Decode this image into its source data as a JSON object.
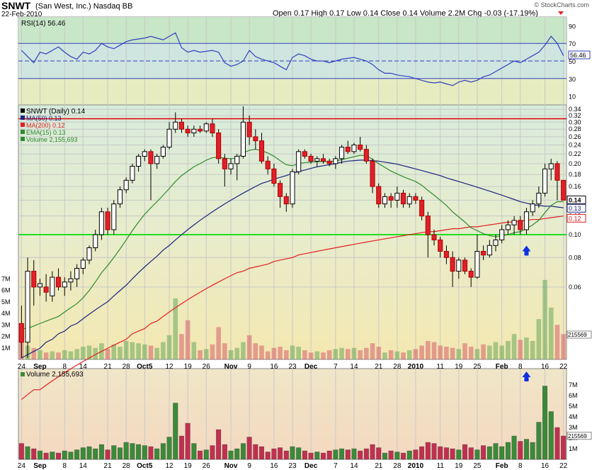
{
  "header": {
    "symbol": "SNWT",
    "company": "(San West, Inc.)",
    "exchange": "Nasdaq BB",
    "date": "22-Feb-2010",
    "open_label": "Open",
    "open": "0.17",
    "high_label": "High",
    "high": "0.17",
    "low_label": "Low",
    "low": "0.14",
    "close_label": "Close",
    "close": "0.14",
    "volume_label": "Volume",
    "volume": "2.2M",
    "chg_label": "Chg",
    "chg": "-0.03 (-17.19%)",
    "watermark": "© StockCharts.com"
  },
  "colors": {
    "up": "#2e7d2e",
    "down": "#e0202a",
    "upbody": "#ffffff",
    "ma50": "#1a237e",
    "ma200": "#e02020",
    "ema15": "#2e8b2e",
    "rsi": "#3040c0"
  },
  "chart_data": {
    "type": "candlestick",
    "x_tick_labels": [
      "24",
      "Sep",
      "8",
      "14",
      "21",
      "28",
      "Oct5",
      "12",
      "19",
      "26",
      "Nov",
      "9",
      "16",
      "23",
      "Dec",
      "7",
      "14",
      "21",
      "28",
      "2010",
      "11",
      "19",
      "25",
      "Feb",
      "8",
      "16",
      "22"
    ],
    "candles": [
      [
        0.042,
        0.05,
        0.03,
        0.035
      ],
      [
        0.035,
        0.08,
        0.03,
        0.07
      ],
      [
        0.07,
        0.078,
        0.05,
        0.06
      ],
      [
        0.06,
        0.065,
        0.055,
        0.062
      ],
      [
        0.06,
        0.068,
        0.052,
        0.057
      ],
      [
        0.055,
        0.07,
        0.052,
        0.066
      ],
      [
        0.066,
        0.072,
        0.058,
        0.06
      ],
      [
        0.06,
        0.066,
        0.055,
        0.063
      ],
      [
        0.063,
        0.07,
        0.058,
        0.065
      ],
      [
        0.065,
        0.075,
        0.06,
        0.072
      ],
      [
        0.072,
        0.08,
        0.068,
        0.078
      ],
      [
        0.078,
        0.09,
        0.075,
        0.088
      ],
      [
        0.088,
        0.105,
        0.085,
        0.1
      ],
      [
        0.1,
        0.13,
        0.095,
        0.125
      ],
      [
        0.125,
        0.13,
        0.1,
        0.105
      ],
      [
        0.105,
        0.14,
        0.1,
        0.135
      ],
      [
        0.135,
        0.16,
        0.13,
        0.155
      ],
      [
        0.155,
        0.175,
        0.15,
        0.17
      ],
      [
        0.17,
        0.2,
        0.165,
        0.195
      ],
      [
        0.195,
        0.22,
        0.185,
        0.215
      ],
      [
        0.215,
        0.23,
        0.205,
        0.225
      ],
      [
        0.225,
        0.23,
        0.14,
        0.2
      ],
      [
        0.2,
        0.22,
        0.19,
        0.215
      ],
      [
        0.215,
        0.24,
        0.21,
        0.235
      ],
      [
        0.235,
        0.3,
        0.23,
        0.28
      ],
      [
        0.28,
        0.33,
        0.27,
        0.3
      ],
      [
        0.3,
        0.31,
        0.27,
        0.28
      ],
      [
        0.28,
        0.29,
        0.26,
        0.27
      ],
      [
        0.27,
        0.29,
        0.26,
        0.28
      ],
      [
        0.28,
        0.29,
        0.27,
        0.275
      ],
      [
        0.275,
        0.3,
        0.27,
        0.295
      ],
      [
        0.295,
        0.31,
        0.26,
        0.27
      ],
      [
        0.27,
        0.28,
        0.2,
        0.21
      ],
      [
        0.21,
        0.22,
        0.16,
        0.19
      ],
      [
        0.19,
        0.21,
        0.18,
        0.2
      ],
      [
        0.2,
        0.22,
        0.17,
        0.215
      ],
      [
        0.215,
        0.35,
        0.21,
        0.3
      ],
      [
        0.3,
        0.32,
        0.24,
        0.26
      ],
      [
        0.26,
        0.28,
        0.23,
        0.25
      ],
      [
        0.25,
        0.27,
        0.2,
        0.205
      ],
      [
        0.205,
        0.215,
        0.18,
        0.19
      ],
      [
        0.19,
        0.2,
        0.16,
        0.165
      ],
      [
        0.165,
        0.17,
        0.13,
        0.145
      ],
      [
        0.145,
        0.15,
        0.125,
        0.135
      ],
      [
        0.135,
        0.19,
        0.13,
        0.185
      ],
      [
        0.185,
        0.23,
        0.18,
        0.225
      ],
      [
        0.225,
        0.23,
        0.21,
        0.215
      ],
      [
        0.215,
        0.22,
        0.2,
        0.205
      ],
      [
        0.205,
        0.215,
        0.195,
        0.21
      ],
      [
        0.21,
        0.22,
        0.2,
        0.205
      ],
      [
        0.205,
        0.21,
        0.195,
        0.2
      ],
      [
        0.2,
        0.215,
        0.19,
        0.21
      ],
      [
        0.21,
        0.24,
        0.2,
        0.235
      ],
      [
        0.235,
        0.25,
        0.22,
        0.225
      ],
      [
        0.225,
        0.245,
        0.22,
        0.24
      ],
      [
        0.24,
        0.26,
        0.225,
        0.23
      ],
      [
        0.23,
        0.24,
        0.2,
        0.205
      ],
      [
        0.205,
        0.21,
        0.15,
        0.16
      ],
      [
        0.16,
        0.165,
        0.13,
        0.135
      ],
      [
        0.135,
        0.15,
        0.13,
        0.145
      ],
      [
        0.145,
        0.15,
        0.13,
        0.14
      ],
      [
        0.14,
        0.16,
        0.13,
        0.15
      ],
      [
        0.15,
        0.155,
        0.13,
        0.135
      ],
      [
        0.135,
        0.15,
        0.13,
        0.145
      ],
      [
        0.145,
        0.15,
        0.135,
        0.14
      ],
      [
        0.14,
        0.145,
        0.115,
        0.12
      ],
      [
        0.12,
        0.125,
        0.08,
        0.1
      ],
      [
        0.1,
        0.105,
        0.09,
        0.095
      ],
      [
        0.095,
        0.098,
        0.08,
        0.085
      ],
      [
        0.085,
        0.09,
        0.075,
        0.08
      ],
      [
        0.08,
        0.085,
        0.06,
        0.07
      ],
      [
        0.07,
        0.08,
        0.065,
        0.078
      ],
      [
        0.078,
        0.08,
        0.068,
        0.07
      ],
      [
        0.07,
        0.072,
        0.06,
        0.066
      ],
      [
        0.066,
        0.1,
        0.065,
        0.085
      ],
      [
        0.085,
        0.09,
        0.078,
        0.082
      ],
      [
        0.082,
        0.095,
        0.08,
        0.09
      ],
      [
        0.09,
        0.1,
        0.085,
        0.095
      ],
      [
        0.095,
        0.11,
        0.092,
        0.105
      ],
      [
        0.105,
        0.115,
        0.1,
        0.11
      ],
      [
        0.11,
        0.12,
        0.1,
        0.115
      ],
      [
        0.115,
        0.12,
        0.1,
        0.105
      ],
      [
        0.105,
        0.13,
        0.1,
        0.125
      ],
      [
        0.125,
        0.14,
        0.12,
        0.135
      ],
      [
        0.135,
        0.16,
        0.13,
        0.15
      ],
      [
        0.15,
        0.2,
        0.145,
        0.19
      ],
      [
        0.19,
        0.21,
        0.17,
        0.2
      ],
      [
        0.2,
        0.205,
        0.14,
        0.17
      ],
      [
        0.17,
        0.17,
        0.14,
        0.14
      ]
    ],
    "volumes": [
      1.5,
      1.2,
      1.0,
      0.8,
      0.6,
      0.7,
      0.6,
      0.8,
      0.7,
      0.9,
      1.1,
      1.2,
      1.0,
      1.4,
      0.9,
      1.3,
      1.1,
      1.6,
      1.5,
      1.4,
      1.3,
      1.2,
      1.0,
      1.5,
      2.1,
      5.3,
      2.2,
      3.4,
      1.5,
      0.8,
      0.9,
      1.3,
      2.8,
      1.4,
      0.8,
      1.0,
      1.5,
      2.1,
      1.4,
      1.2,
      0.7,
      1.0,
      1.1,
      0.8,
      1.2,
      1.1,
      0.8,
      0.6,
      0.7,
      0.6,
      0.8,
      0.9,
      1.0,
      0.9,
      1.0,
      0.8,
      1.0,
      1.4,
      1.1,
      0.6,
      0.8,
      0.7,
      0.6,
      0.8,
      0.9,
      1.2,
      1.6,
      1.5,
      1.2,
      1.1,
      1.0,
      0.9,
      1.4,
      1.1,
      0.9,
      1.3,
      1.2,
      1.5,
      1.2,
      1.6,
      2.2,
      1.7,
      1.9,
      1.6,
      3.5,
      6.9,
      4.5,
      3.0,
      2.2
    ],
    "ma50": [
      0.03,
      0.031,
      0.032,
      0.033,
      0.035,
      0.036,
      0.038,
      0.039,
      0.041,
      0.042,
      0.044,
      0.046,
      0.048,
      0.05,
      0.052,
      0.055,
      0.058,
      0.061,
      0.065,
      0.069,
      0.073,
      0.077,
      0.081,
      0.086,
      0.09,
      0.095,
      0.1,
      0.105,
      0.11,
      0.115,
      0.12,
      0.125,
      0.13,
      0.135,
      0.14,
      0.145,
      0.15,
      0.155,
      0.16,
      0.165,
      0.168,
      0.172,
      0.175,
      0.178,
      0.182,
      0.185,
      0.188,
      0.191,
      0.194,
      0.196,
      0.198,
      0.2,
      0.203,
      0.205,
      0.206,
      0.207,
      0.207,
      0.206,
      0.205,
      0.203,
      0.201,
      0.199,
      0.196,
      0.193,
      0.19,
      0.187,
      0.184,
      0.181,
      0.178,
      0.174,
      0.171,
      0.168,
      0.165,
      0.162,
      0.159,
      0.156,
      0.153,
      0.15,
      0.147,
      0.144,
      0.141,
      0.138,
      0.136,
      0.134,
      0.133,
      0.132,
      0.132,
      0.131,
      0.13
    ],
    "ma200": [
      0.02,
      0.021,
      0.022,
      0.022,
      0.023,
      0.024,
      0.025,
      0.026,
      0.027,
      0.028,
      0.029,
      0.03,
      0.031,
      0.032,
      0.033,
      0.034,
      0.035,
      0.036,
      0.038,
      0.039,
      0.04,
      0.042,
      0.043,
      0.045,
      0.047,
      0.049,
      0.051,
      0.053,
      0.055,
      0.057,
      0.059,
      0.061,
      0.063,
      0.065,
      0.067,
      0.069,
      0.07,
      0.072,
      0.073,
      0.074,
      0.075,
      0.077,
      0.078,
      0.079,
      0.08,
      0.082,
      0.083,
      0.084,
      0.085,
      0.086,
      0.087,
      0.088,
      0.089,
      0.09,
      0.091,
      0.092,
      0.093,
      0.094,
      0.095,
      0.096,
      0.097,
      0.098,
      0.099,
      0.1,
      0.101,
      0.102,
      0.103,
      0.103,
      0.104,
      0.105,
      0.106,
      0.106,
      0.107,
      0.108,
      0.108,
      0.109,
      0.11,
      0.111,
      0.112,
      0.113,
      0.113,
      0.114,
      0.115,
      0.116,
      0.116,
      0.117,
      0.118,
      0.119,
      0.12
    ],
    "ema15": [
      0.04,
      0.04,
      0.041,
      0.042,
      0.043,
      0.044,
      0.045,
      0.047,
      0.049,
      0.051,
      0.054,
      0.058,
      0.063,
      0.069,
      0.074,
      0.08,
      0.087,
      0.095,
      0.104,
      0.113,
      0.122,
      0.13,
      0.138,
      0.147,
      0.157,
      0.168,
      0.178,
      0.186,
      0.194,
      0.2,
      0.207,
      0.212,
      0.213,
      0.211,
      0.21,
      0.211,
      0.222,
      0.228,
      0.23,
      0.227,
      0.222,
      0.215,
      0.206,
      0.198,
      0.196,
      0.2,
      0.202,
      0.203,
      0.204,
      0.204,
      0.204,
      0.205,
      0.208,
      0.211,
      0.214,
      0.217,
      0.216,
      0.209,
      0.2,
      0.193,
      0.186,
      0.181,
      0.176,
      0.172,
      0.168,
      0.162,
      0.154,
      0.147,
      0.14,
      0.133,
      0.125,
      0.119,
      0.113,
      0.107,
      0.104,
      0.101,
      0.099,
      0.098,
      0.099,
      0.1,
      0.102,
      0.103,
      0.106,
      0.11,
      0.115,
      0.124,
      0.133,
      0.138,
      0.138
    ],
    "rsi": [
      62,
      55,
      48,
      60,
      58,
      62,
      66,
      60,
      55,
      52,
      60,
      58,
      62,
      70,
      66,
      64,
      68,
      72,
      74,
      75,
      76,
      78,
      76,
      74,
      78,
      82,
      65,
      60,
      62,
      60,
      61,
      62,
      60,
      48,
      44,
      46,
      50,
      62,
      55,
      52,
      50,
      48,
      44,
      40,
      54,
      58,
      56,
      52,
      50,
      50,
      48,
      50,
      52,
      53,
      54,
      52,
      50,
      46,
      40,
      36,
      36,
      34,
      33,
      32,
      30,
      28,
      26,
      25,
      26,
      24,
      22,
      26,
      28,
      26,
      28,
      32,
      34,
      38,
      42,
      46,
      50,
      48,
      52,
      56,
      60,
      68,
      78,
      70,
      56
    ],
    "rsi_ticks": [
      10,
      30,
      50,
      70,
      90
    ],
    "price_ticks": [
      0.06,
      0.08,
      0.1,
      0.12,
      0.14,
      0.16,
      0.18,
      0.2,
      0.22,
      0.24,
      0.26,
      0.28,
      0.3,
      0.32,
      0.34
    ],
    "price_range": [
      0.03,
      0.35
    ],
    "volume_ticks": [
      "1M",
      "2M",
      "3M",
      "4M",
      "5M",
      "6M",
      "7M"
    ],
    "hlines": {
      "support": 0.1,
      "resistance": 0.31
    },
    "rsi_legend": "RSI(14) 56.46",
    "rsi_value_label": "56.46",
    "price_legend": [
      "SNWT (Daily) 0.14",
      "MA(50) 0.13",
      "MA(200) 0.12",
      "EMA(15) 0.13",
      "Volume 2,155,693"
    ],
    "last_labels": {
      "close": "0.14",
      "ma50": "0.13",
      "ma200": "0.12"
    },
    "volume_last_label": "215569",
    "volume_legend": "Volume 2,155,693",
    "arrows_at_index": 82
  }
}
